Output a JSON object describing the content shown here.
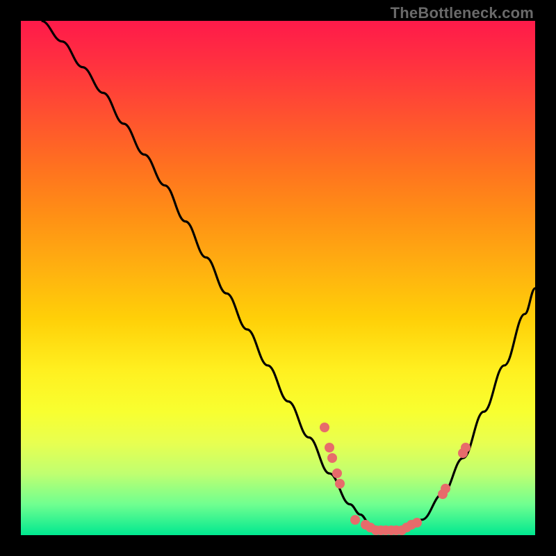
{
  "watermark": "TheBottleneck.com",
  "chart_data": {
    "type": "line",
    "title": "",
    "xlabel": "",
    "ylabel": "",
    "xlim": [
      0,
      100
    ],
    "ylim": [
      0,
      100
    ],
    "series": [
      {
        "name": "curve",
        "x": [
          4,
          8,
          12,
          16,
          20,
          24,
          28,
          32,
          36,
          40,
          44,
          48,
          52,
          56,
          60,
          64,
          66,
          68,
          70,
          74,
          78,
          82,
          86,
          90,
          94,
          98,
          100
        ],
        "y": [
          100,
          96,
          91,
          86,
          80,
          74,
          68,
          61,
          54,
          47,
          40,
          33,
          26,
          19,
          12,
          6,
          4,
          2,
          1,
          1,
          3,
          8,
          15,
          24,
          33,
          43,
          48
        ]
      }
    ],
    "points": [
      {
        "name": "p1",
        "x": 59,
        "y": 21
      },
      {
        "name": "p2",
        "x": 60,
        "y": 17
      },
      {
        "name": "p3",
        "x": 60.5,
        "y": 15
      },
      {
        "name": "p4",
        "x": 61.5,
        "y": 12
      },
      {
        "name": "p5",
        "x": 62,
        "y": 10
      },
      {
        "name": "p6",
        "x": 65,
        "y": 3
      },
      {
        "name": "p7",
        "x": 67,
        "y": 2
      },
      {
        "name": "p8",
        "x": 68,
        "y": 1.5
      },
      {
        "name": "p9",
        "x": 69,
        "y": 1
      },
      {
        "name": "p10",
        "x": 70,
        "y": 1
      },
      {
        "name": "p11",
        "x": 71,
        "y": 1
      },
      {
        "name": "p12",
        "x": 72,
        "y": 1
      },
      {
        "name": "p13",
        "x": 73,
        "y": 1
      },
      {
        "name": "p14",
        "x": 74,
        "y": 1
      },
      {
        "name": "p15",
        "x": 75,
        "y": 1.5
      },
      {
        "name": "p16",
        "x": 76,
        "y": 2
      },
      {
        "name": "p17",
        "x": 77,
        "y": 2.5
      },
      {
        "name": "p18",
        "x": 82,
        "y": 8
      },
      {
        "name": "p19",
        "x": 82.5,
        "y": 9
      },
      {
        "name": "p20",
        "x": 86,
        "y": 16
      },
      {
        "name": "p21",
        "x": 86.5,
        "y": 17
      }
    ]
  }
}
